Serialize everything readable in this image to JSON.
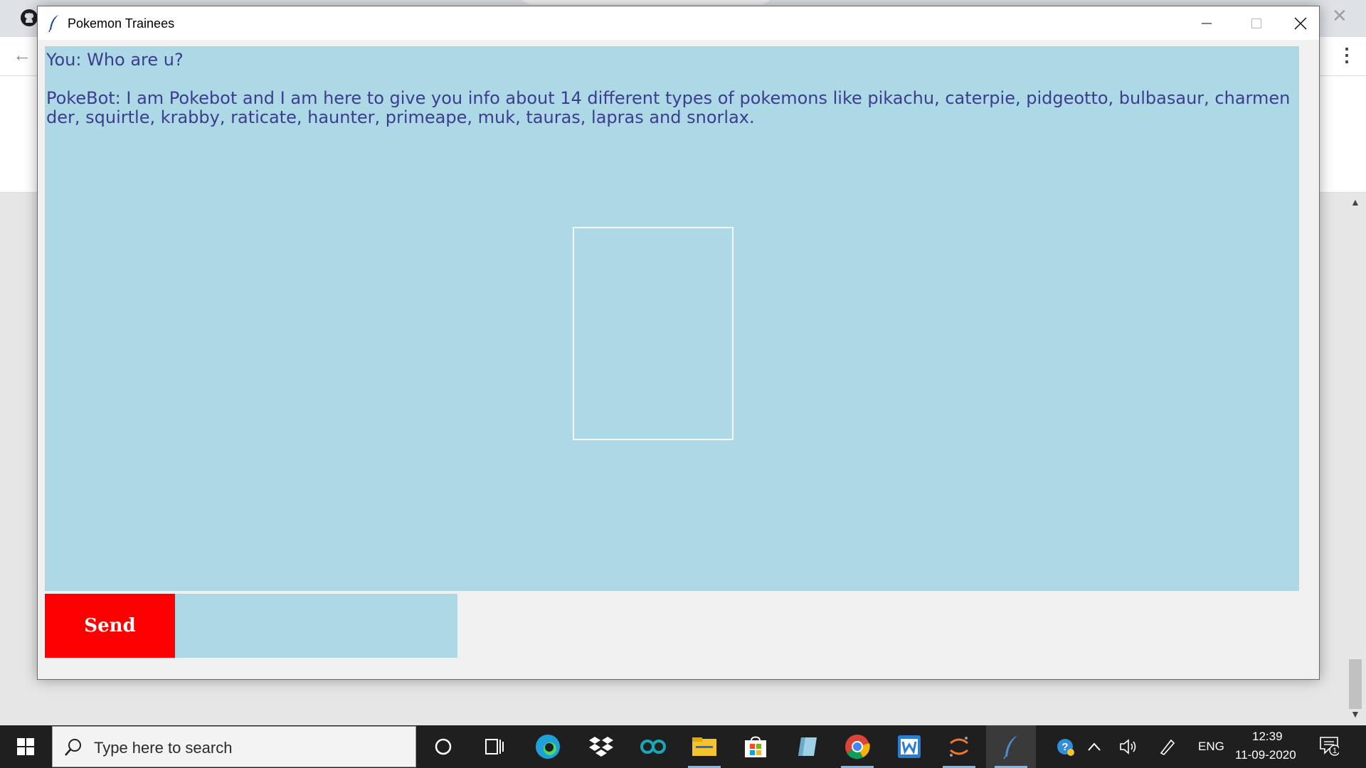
{
  "window": {
    "title": "Pokemon Trainees"
  },
  "chat": {
    "messages": [
      "You: Who are u?",
      "PokeBot: I am Pokebot and I am here to give you info about 14 different types of pokemons like pikachu, caterpie, pidgeotto, bulbasaur, charmender, squirtle, krabby, raticate, haunter, primeape, muk, tauras, lapras and snorlax."
    ]
  },
  "composer": {
    "send_label": "Send",
    "input_value": ""
  },
  "taskbar": {
    "search_placeholder": "Type here to search",
    "apps": [
      "cortana-icon",
      "task-view-icon",
      "edge-icon",
      "dropbox-icon",
      "arduino-icon",
      "file-explorer-icon",
      "store-icon",
      "notes-icon",
      "chrome-icon",
      "word-icon",
      "jupyter-icon",
      "python-tk-icon"
    ],
    "language": "ENG",
    "time": "12:39",
    "date": "11-09-2020",
    "notifications": "1"
  },
  "colors": {
    "chat_bg": "#add8e6",
    "chat_text": "#3d3d8f",
    "send_bg": "#ff0000",
    "send_text": "#ffffff"
  }
}
